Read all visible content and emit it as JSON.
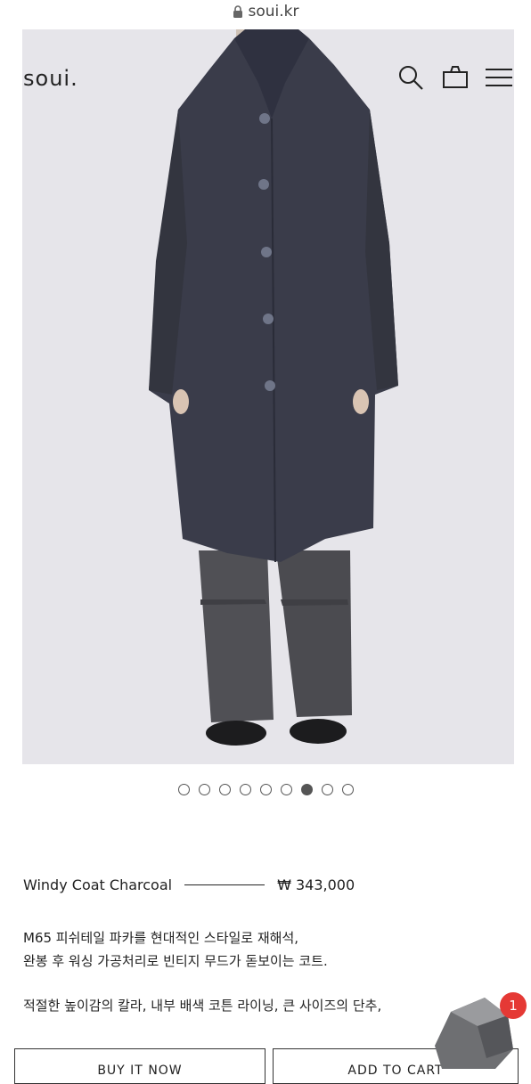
{
  "browser": {
    "url": "soui.kr"
  },
  "header": {
    "logo": "soui."
  },
  "product": {
    "name": "Windy Coat Charcoal",
    "price": "₩ 343,000",
    "description_lines": [
      "M65 피쉬테일 파카를 현대적인 스타일로 재해석,",
      "완봉 후 워싱 가공처리로 빈티지 무드가 돋보이는 코트.",
      "적절한 높이감의 칼라, 내부 배색 코튼 라이닝, 큰 사이즈의 단추,"
    ]
  },
  "gallery": {
    "total_images": 9,
    "active_index": 7
  },
  "actions": {
    "buy_label": "BUY IT NOW",
    "cart_label": "ADD TO CART"
  },
  "chat": {
    "badge_count": "1"
  },
  "colors": {
    "coat": "#3a3c4a",
    "pants": "#505055",
    "photo_bg": "#e6e5ea",
    "badge": "#e53935"
  }
}
